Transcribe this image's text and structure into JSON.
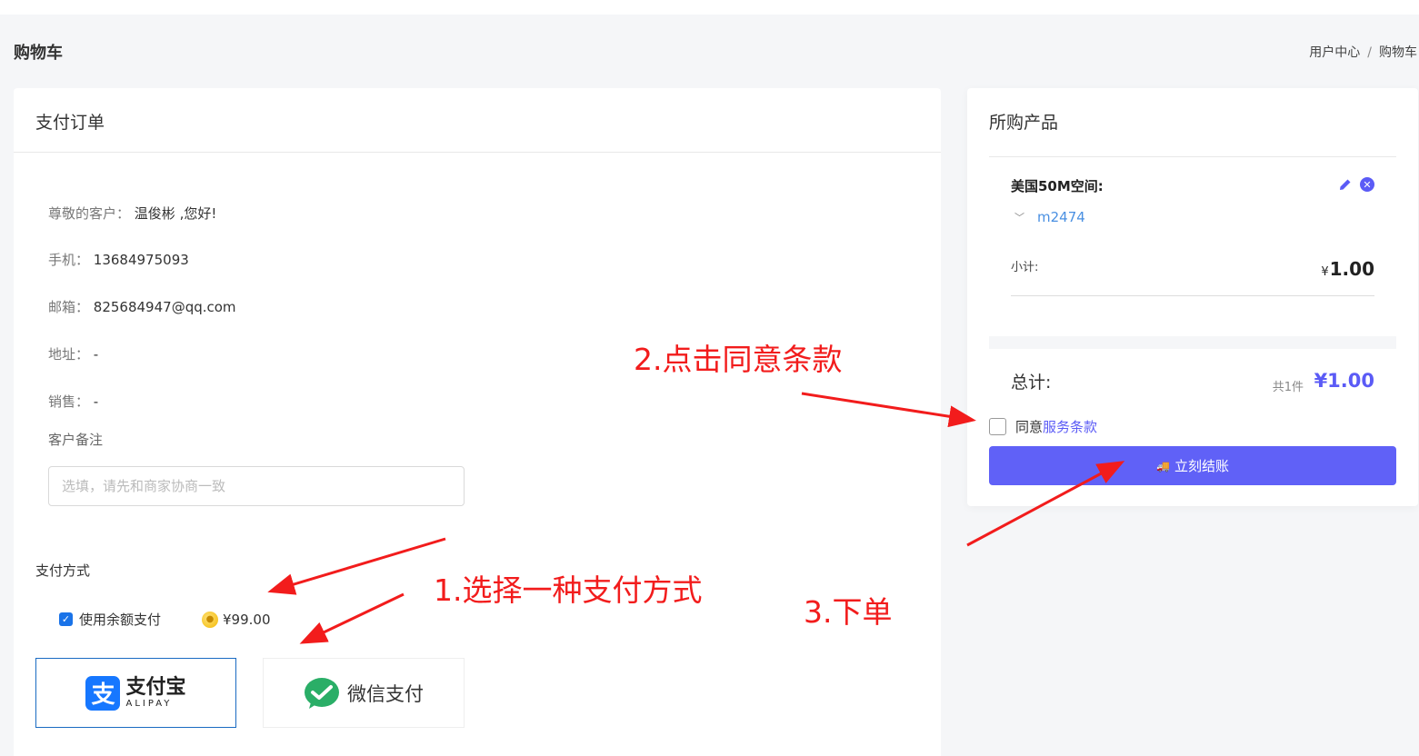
{
  "header": {
    "title": "购物车",
    "breadcrumb": [
      "用户中心",
      "购物车"
    ]
  },
  "order": {
    "title": "支付订单",
    "greeting_label": "尊敬的客户：",
    "greeting_value": "温俊彬 ,您好!",
    "phone_label": "手机：",
    "phone_value": "13684975093",
    "email_label": "邮箱：",
    "email_value": "825684947@qq.com",
    "address_label": "地址：",
    "address_value": "-",
    "sales_label": "销售：",
    "sales_value": "-",
    "remark_label": "客户备注",
    "remark_placeholder": "选填，请先和商家协商一致",
    "payment_title": "支付方式",
    "balance_label": "使用余额支付",
    "balance_value": "¥99.00",
    "alipay_cn": "支付宝",
    "alipay_en": "ALIPAY",
    "alipay_mark": "支",
    "wechat_label": "微信支付"
  },
  "cart": {
    "title": "所购产品",
    "product_name": "美国50M空间:",
    "product_sub": "m2474",
    "subtotal_label": "小计:",
    "subtotal_currency": "¥",
    "subtotal_value": "1.00",
    "total_label": "总计:",
    "total_count": "共1件",
    "total_value": "¥1.00",
    "agree_text": "同意",
    "terms_link": "服务条款",
    "checkout_label": "立刻结账"
  },
  "annotations": {
    "step1": "1.选择一种支付方式",
    "step2": "2.点击同意条款",
    "step3": "3.下单"
  },
  "colors": {
    "accent": "#6061f7",
    "annotation": "#f21c1c",
    "alipay_blue": "#1677ff",
    "wechat_green": "#2aae67"
  },
  "icons": {
    "edit": "pencil-icon",
    "remove": "close-circle-icon",
    "expand": "chevron-down-icon",
    "coin": "coin-icon",
    "checkout": "truck-icon"
  }
}
